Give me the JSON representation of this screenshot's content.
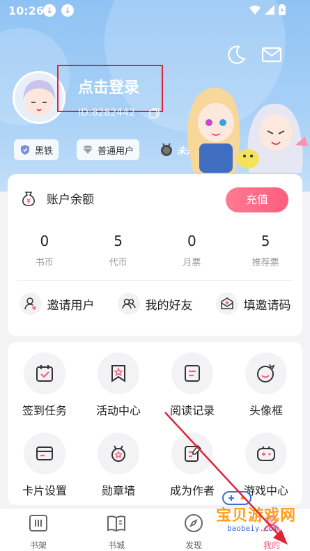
{
  "status": {
    "time": "10:26"
  },
  "profile": {
    "login_prompt": "点击登录",
    "user_id": "ID:8282442",
    "badges": [
      "黑铁",
      "普通用户"
    ],
    "unopened": "未开通"
  },
  "account": {
    "title": "账户余额",
    "recharge": "充值",
    "stats": [
      {
        "value": "0",
        "label": "书币"
      },
      {
        "value": "5",
        "label": "代币"
      },
      {
        "value": "0",
        "label": "月票"
      },
      {
        "value": "5",
        "label": "推荐票"
      }
    ],
    "links": [
      "邀请用户",
      "我的好友",
      "填邀请码"
    ]
  },
  "features": [
    {
      "label": "签到任务",
      "icon": "calendar-check-icon"
    },
    {
      "label": "活动中心",
      "icon": "bookmark-star-icon"
    },
    {
      "label": "阅读记录",
      "icon": "document-lines-icon"
    },
    {
      "label": "头像框",
      "icon": "smiley-crown-icon"
    },
    {
      "label": "卡片设置",
      "icon": "card-icon"
    },
    {
      "label": "勋章墙",
      "icon": "medal-icon"
    },
    {
      "label": "成为作者",
      "icon": "pen-document-icon"
    },
    {
      "label": "游戏中心",
      "icon": "gamepad-icon"
    }
  ],
  "tabs": [
    {
      "label": "书架",
      "icon": "bookshelf-icon"
    },
    {
      "label": "书城",
      "icon": "book-open-icon"
    },
    {
      "label": "发现",
      "icon": "compass-icon"
    },
    {
      "label": "我的",
      "icon": "user-icon",
      "active": true
    }
  ],
  "watermark": {
    "brand": "宝贝游戏网",
    "url": "baobeiy.com"
  },
  "colors": {
    "accent": "#ff5d7d",
    "header": "#8fc2f3",
    "highlight": "#e0223a"
  }
}
